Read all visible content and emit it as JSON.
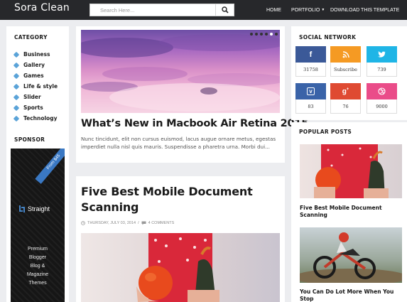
{
  "header": {
    "logo": "Sora Clean",
    "search_placeholder": "Search Here...",
    "nav": [
      "Home",
      "Portfolio",
      "Download This Template"
    ]
  },
  "left_sidebar": {
    "category_title": "CATEGORY",
    "categories": [
      "Business",
      "Gallery",
      "Games",
      "Life & style",
      "Slider",
      "Sports",
      "Technology"
    ],
    "sponsor_title": "SPONSOR",
    "ad": {
      "ribbon": "From $45",
      "brand": "Straight",
      "copy": [
        "Premium",
        "Blogger",
        "Blog &",
        "Magazine",
        "Themes"
      ]
    }
  },
  "main": {
    "featured": {
      "title": "What’s New in Macbook Air Retina 2015",
      "excerpt": "Nunc tincidunt, elit non cursus euismod, lacus augue ornare metus, egestas imperdiet nulla nisl quis mauris. Suspendisse a pharetra urna. Morbi dui..."
    },
    "post2": {
      "title_line1": "Five Best Mobile Document",
      "title_line2": "Scanning",
      "date": "THURSDAY, JULY 03, 2014",
      "separator": "/",
      "comments": "4 COMMENTS"
    }
  },
  "right_sidebar": {
    "social_title": "SOCIAL NETWORK",
    "social": [
      {
        "name": "facebook",
        "count": "31758",
        "color": "#3b5998"
      },
      {
        "name": "rss",
        "count": "Subscribe",
        "color": "#f59a23"
      },
      {
        "name": "twitter",
        "count": "739",
        "color": "#1fb5e6"
      },
      {
        "name": "vimeo",
        "count": "83",
        "color": "#3a63a8"
      },
      {
        "name": "google-plus",
        "count": "76",
        "color": "#df4a32"
      },
      {
        "name": "dribbble",
        "count": "9000",
        "color": "#ea4c89"
      }
    ],
    "popular_title": "POPULAR POSTS",
    "popular": [
      {
        "title_line1": "Five Best Mobile Document",
        "title_line2": "Scanning"
      },
      {
        "title_line1": "You Can Do Lot More When You",
        "title_line2": "Stop"
      }
    ]
  }
}
